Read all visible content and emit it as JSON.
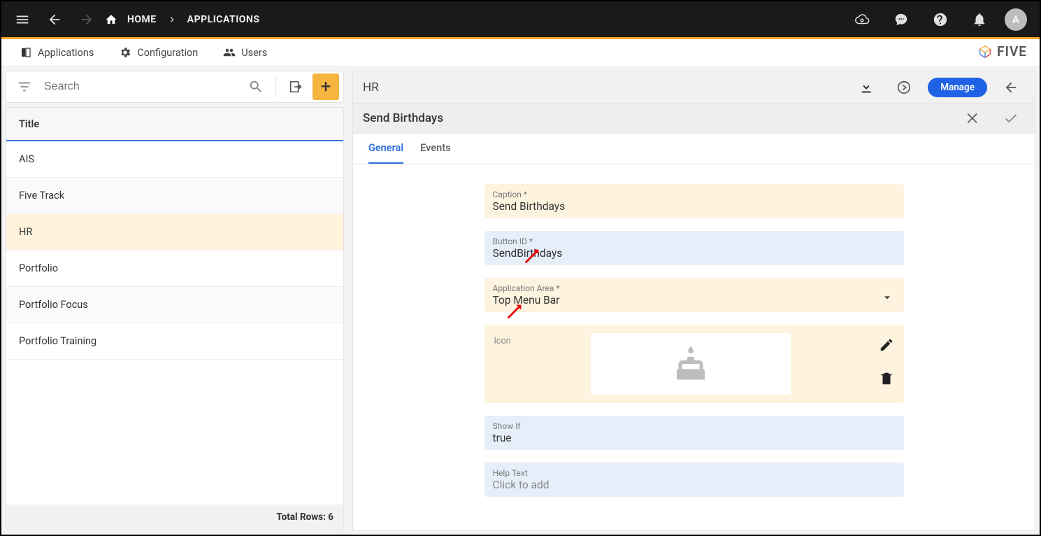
{
  "topbar": {
    "breadcrumbs": [
      "HOME",
      "APPLICATIONS"
    ],
    "avatar_letter": "A"
  },
  "navrow": {
    "tabs": [
      {
        "label": "Applications"
      },
      {
        "label": "Configuration"
      },
      {
        "label": "Users"
      }
    ],
    "brand": "FIVE"
  },
  "left": {
    "search_placeholder": "Search",
    "header": "Title",
    "rows": [
      "AIS",
      "Five Track",
      "HR",
      "Portfolio",
      "Portfolio Focus",
      "Portfolio Training"
    ],
    "selected_index": 2,
    "footer_label": "Total Rows:",
    "footer_count": "6"
  },
  "page": {
    "title": "HR",
    "manage_label": "Manage",
    "subtitle": "Send Birthdays",
    "tabs": [
      "General",
      "Events"
    ],
    "active_tab_index": 0
  },
  "form": {
    "caption": {
      "label": "Caption *",
      "value": "Send Birthdays"
    },
    "button_id": {
      "label": "Button ID *",
      "value": "SendBirthdays"
    },
    "app_area": {
      "label": "Application Area *",
      "value": "Top Menu Bar"
    },
    "icon": {
      "label": "Icon"
    },
    "show_if": {
      "label": "Show If",
      "value": "true"
    },
    "help_text": {
      "label": "Help Text",
      "placeholder": "Click to add"
    }
  }
}
